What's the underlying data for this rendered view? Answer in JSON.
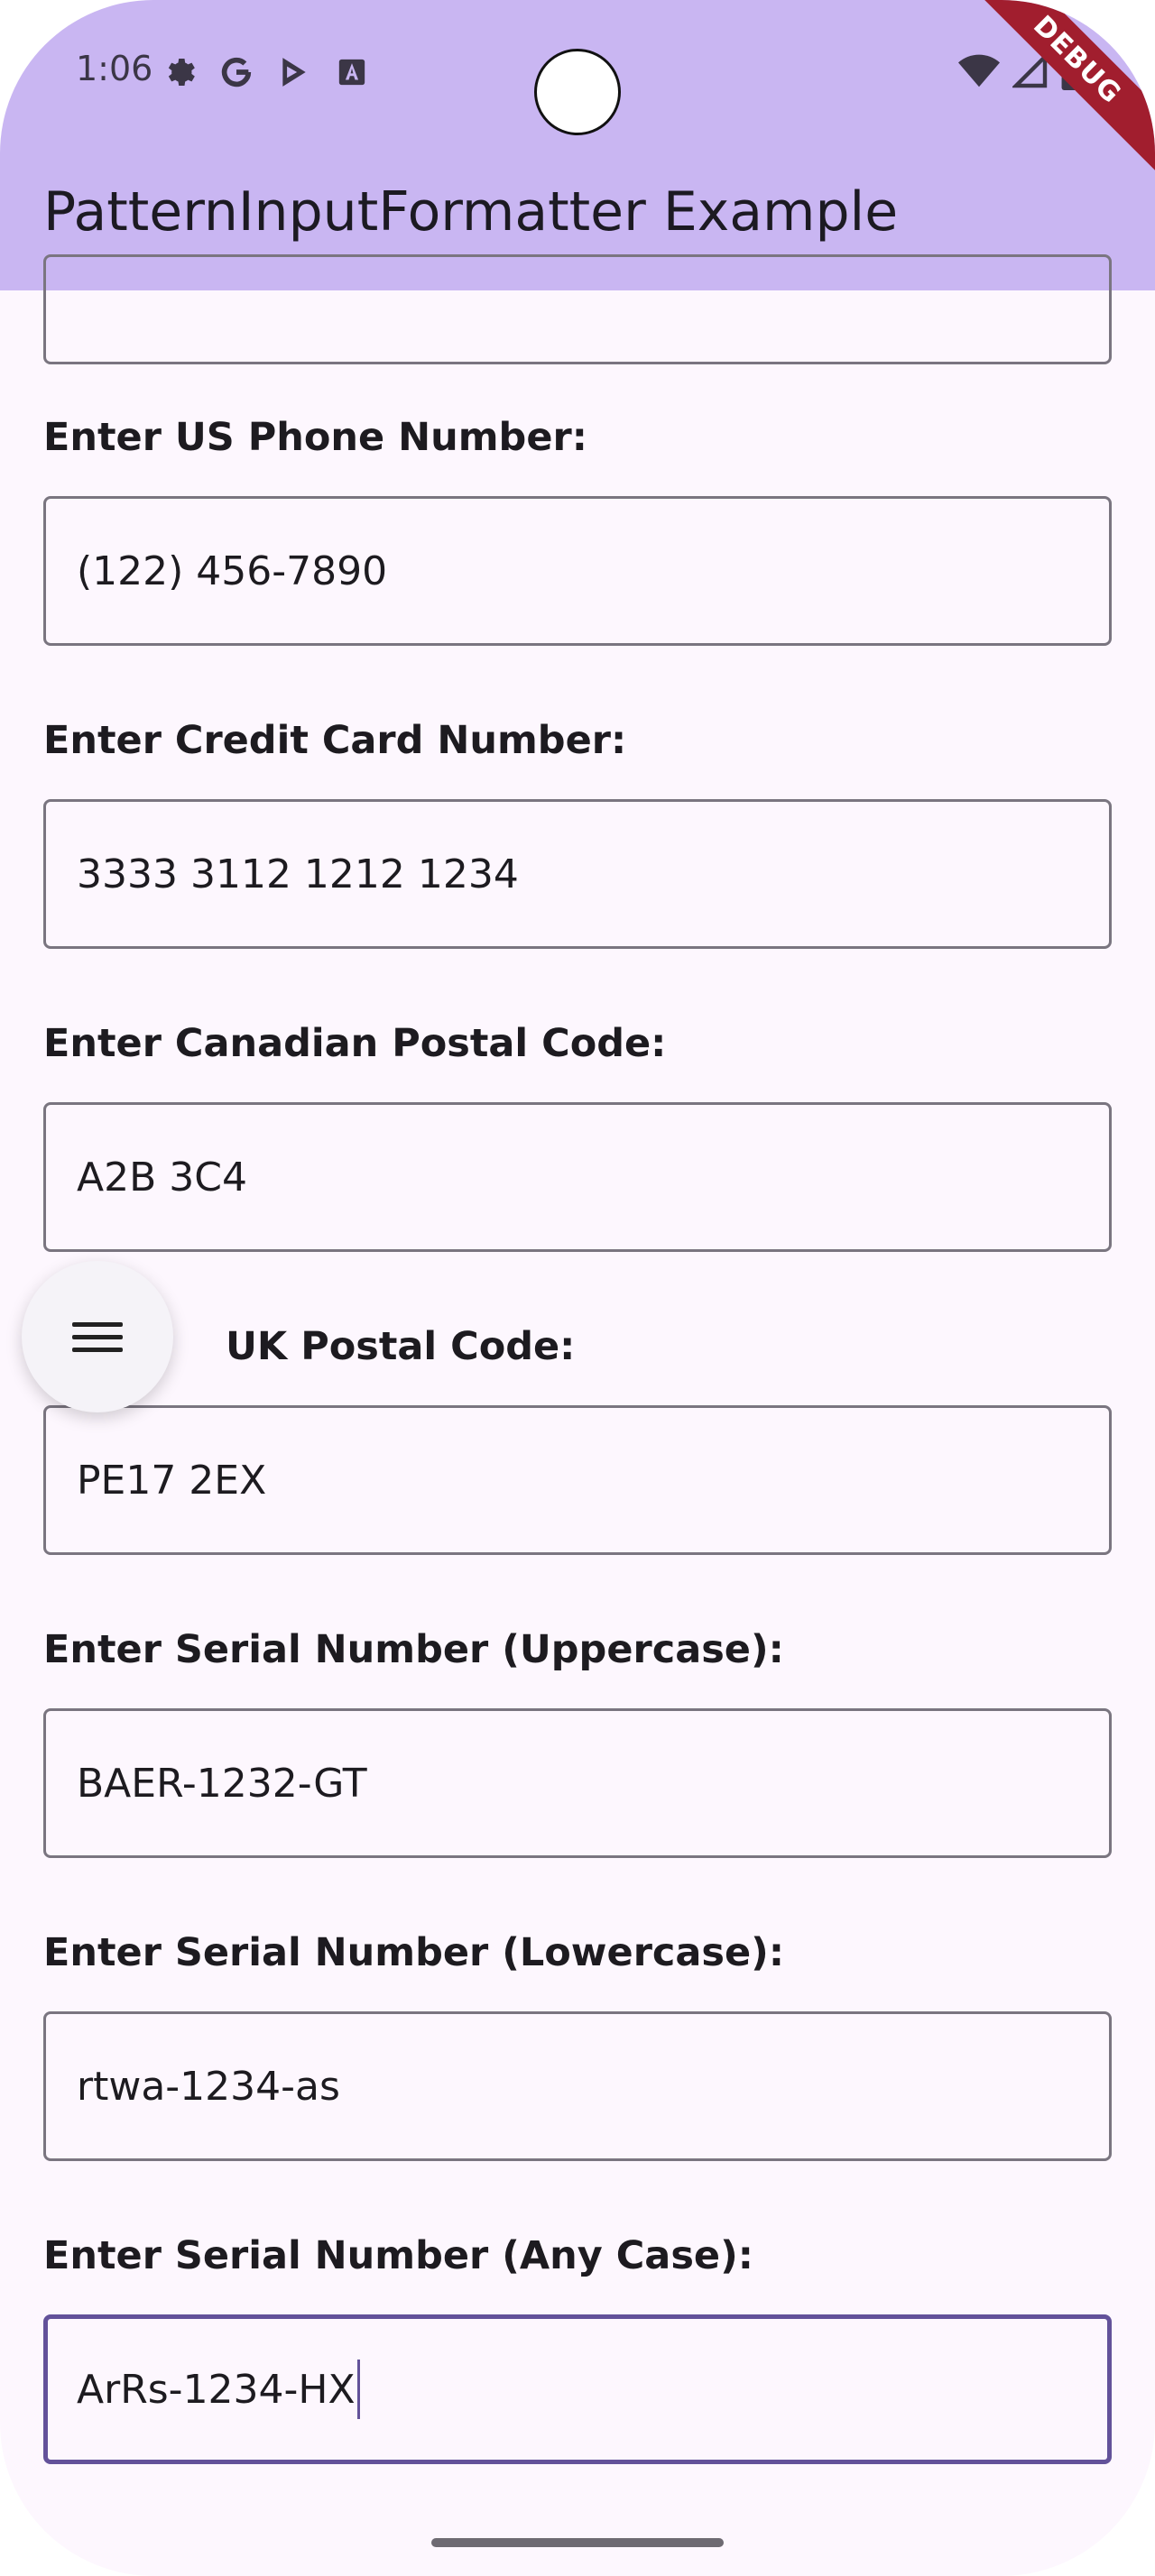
{
  "status_bar": {
    "time": "1:06",
    "left_icons": [
      "gear-icon",
      "google-icon",
      "play-store-icon",
      "text-a-icon"
    ],
    "right_icons": [
      "wifi-icon",
      "signal-icon",
      "battery-icon"
    ]
  },
  "debug_banner": "DEBUG",
  "app_bar": {
    "title": "PatternInputFormatter Example"
  },
  "fields": [
    {
      "label": "Enter US Phone Number:",
      "value": "(122) 456-7890"
    },
    {
      "label": "Enter Credit Card Number:",
      "value": "3333 3112 1212 1234"
    },
    {
      "label": "Enter Canadian Postal Code:",
      "value": "A2B 3C4"
    },
    {
      "label": "UK Postal Code:",
      "value": "PE17 2EX"
    },
    {
      "label": "Enter Serial Number (Uppercase):",
      "value": "BAER-1232-GT"
    },
    {
      "label": "Enter Serial Number (Lowercase):",
      "value": "rtwa-1234-as"
    },
    {
      "label": "Enter Serial Number (Any Case):",
      "value": "ArRs-1234-HX"
    }
  ],
  "fab": {
    "icon": "menu-icon"
  },
  "colors": {
    "app_bar": "#c9b6f2",
    "background": "#fdf7fe",
    "focus": "#63529a",
    "debug": "#a11e2e"
  }
}
